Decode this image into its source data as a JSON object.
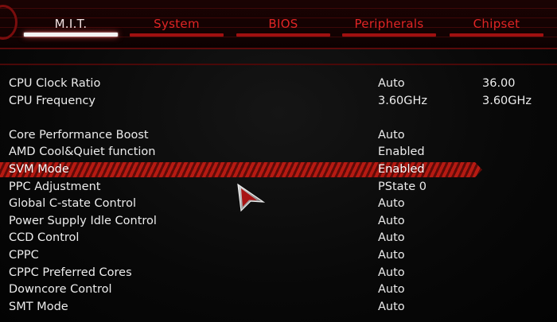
{
  "tabs": [
    {
      "label": "M.I.T.",
      "active": true
    },
    {
      "label": "System",
      "active": false
    },
    {
      "label": "BIOS",
      "active": false
    },
    {
      "label": "Peripherals",
      "active": false
    },
    {
      "label": "Chipset",
      "active": false
    }
  ],
  "settings": {
    "cpu_clock_ratio": {
      "label": "CPU Clock Ratio",
      "value": "Auto",
      "current": "36.00"
    },
    "cpu_frequency": {
      "label": "CPU Frequency",
      "value": "3.60GHz",
      "current": "3.60GHz"
    },
    "items": [
      {
        "label": "Core Performance Boost",
        "value": "Auto"
      },
      {
        "label": "AMD Cool&Quiet function",
        "value": "Enabled"
      },
      {
        "label": "SVM Mode",
        "value": "Enabled",
        "selected": true
      },
      {
        "label": "PPC Adjustment",
        "value": "PState 0"
      },
      {
        "label": "Global C-state Control",
        "value": "Auto"
      },
      {
        "label": "Power Supply Idle Control",
        "value": "Auto"
      },
      {
        "label": "CCD Control",
        "value": "Auto"
      },
      {
        "label": "CPPC",
        "value": "Auto"
      },
      {
        "label": "CPPC Preferred Cores",
        "value": "Auto"
      },
      {
        "label": "Downcore Control",
        "value": "Auto"
      },
      {
        "label": "SMT Mode",
        "value": "Auto"
      }
    ]
  },
  "colors": {
    "accent_red": "#e02525",
    "tab_bar_red": "#a01010",
    "highlight_stripe": "#b61a12",
    "text": "#ececec",
    "background": "#060606"
  },
  "icons": {
    "cursor": "arrow-cursor-icon"
  }
}
